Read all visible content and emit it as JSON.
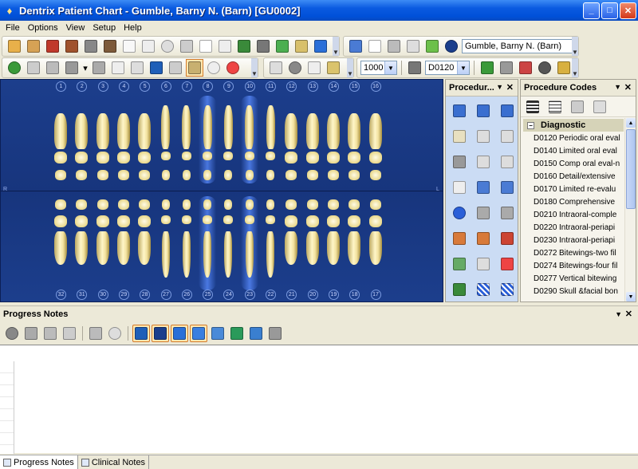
{
  "window": {
    "title": "Dentrix Patient Chart - Gumble, Barny N. (Barn) [GU0002]"
  },
  "menu": [
    "File",
    "Options",
    "View",
    "Setup",
    "Help"
  ],
  "patient_field": "Gumble, Barny N. (Barn)",
  "toolbar2": {
    "provider_select": "1000",
    "code_select": "D0120"
  },
  "chart": {
    "left_label": "R",
    "right_label": "L",
    "upper_numbers": [
      "1",
      "2",
      "3",
      "4",
      "5",
      "6",
      "7",
      "8",
      "9",
      "10",
      "11",
      "12",
      "13",
      "14",
      "15",
      "16"
    ],
    "lower_numbers": [
      "32",
      "31",
      "30",
      "29",
      "28",
      "27",
      "26",
      "25",
      "24",
      "23",
      "22",
      "21",
      "20",
      "19",
      "18",
      "17"
    ],
    "highlighted_upper": [
      "8",
      "10"
    ],
    "highlighted_lower": [
      "25",
      "23"
    ]
  },
  "procedure_panel": {
    "title": "Procedur..."
  },
  "codes_panel": {
    "title": "Procedure Codes",
    "group": "Diagnostic",
    "codes": [
      {
        "code": "D0120",
        "desc": "Periodic oral eval"
      },
      {
        "code": "D0140",
        "desc": "Limited oral eval"
      },
      {
        "code": "D0150",
        "desc": "Comp oral eval-n"
      },
      {
        "code": "D0160",
        "desc": "Detail/extensive"
      },
      {
        "code": "D0170",
        "desc": "Limited re-evalu"
      },
      {
        "code": "D0180",
        "desc": "Comprehensive"
      },
      {
        "code": "D0210",
        "desc": "Intraoral-comple"
      },
      {
        "code": "D0220",
        "desc": "Intraoral-periapi"
      },
      {
        "code": "D0230",
        "desc": "Intraoral-periapi"
      },
      {
        "code": "D0272",
        "desc": "Bitewings-two fil"
      },
      {
        "code": "D0274",
        "desc": "Bitewings-four fil"
      },
      {
        "code": "D0277",
        "desc": "Vertical bitewing"
      },
      {
        "code": "D0290",
        "desc": "Skull &facial bon"
      }
    ]
  },
  "progress_notes": {
    "title": "Progress Notes"
  },
  "tabs": [
    "Progress Notes",
    "Clinical Notes"
  ],
  "colors": {
    "chart_bg": "#1c3e8c",
    "titlebar": "#0a5ae0",
    "highlight": "#5a8cff"
  }
}
